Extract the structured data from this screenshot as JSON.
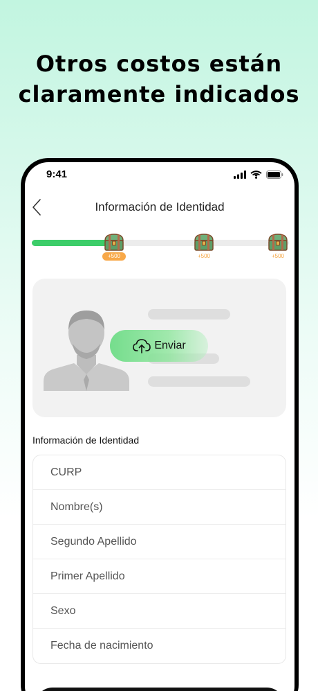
{
  "headline": {
    "line1": "Otros costos están",
    "line2": "claramente indicados"
  },
  "status_bar": {
    "time": "9:41",
    "icons": [
      "signal-icon",
      "wifi-icon",
      "battery-icon"
    ]
  },
  "nav": {
    "title": "Información de Identidad",
    "back_icon": "chevron-left-icon"
  },
  "progress": {
    "fraction": 0.31,
    "fill_color": "#3ccd69",
    "rewards": [
      {
        "label": "+500",
        "active": true
      },
      {
        "label": "+500",
        "active": false
      },
      {
        "label": "+500",
        "active": false
      }
    ]
  },
  "upload": {
    "button_label": "Enviar",
    "icon": "cloud-upload-icon",
    "placeholder_icon": "person-silhouette-icon"
  },
  "section": {
    "title": "Información de Identidad"
  },
  "fields": [
    {
      "placeholder": "CURP"
    },
    {
      "placeholder": "Nombre(s)"
    },
    {
      "placeholder": "Segundo Apellido"
    },
    {
      "placeholder": "Primer Apellido"
    },
    {
      "placeholder": "Sexo"
    },
    {
      "placeholder": "Fecha de nacimiento"
    }
  ]
}
